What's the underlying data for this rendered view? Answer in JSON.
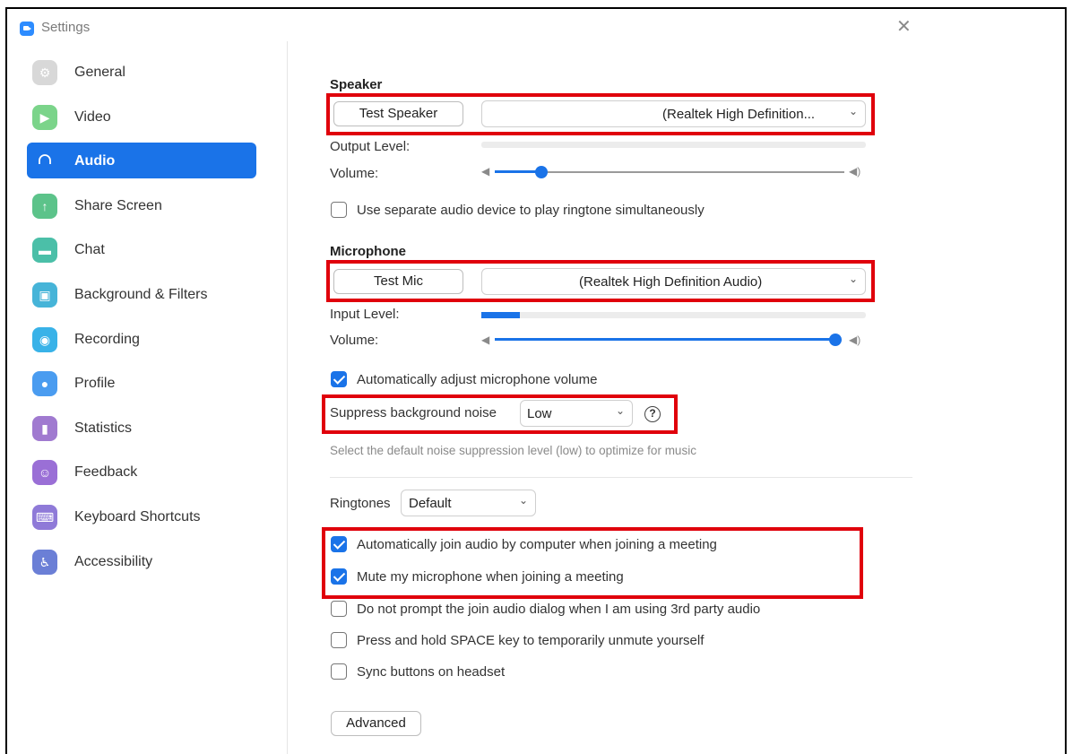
{
  "window": {
    "title": "Settings",
    "close_glyph": "✕"
  },
  "sidebar": {
    "items": [
      {
        "label": "General",
        "icon": "gear-icon"
      },
      {
        "label": "Video",
        "icon": "video-camera-icon"
      },
      {
        "label": "Audio",
        "icon": "headphones-icon",
        "active": true
      },
      {
        "label": "Share Screen",
        "icon": "share-screen-icon"
      },
      {
        "label": "Chat",
        "icon": "chat-bubble-icon"
      },
      {
        "label": "Background & Filters",
        "icon": "background-icon"
      },
      {
        "label": "Recording",
        "icon": "record-icon"
      },
      {
        "label": "Profile",
        "icon": "profile-icon"
      },
      {
        "label": "Statistics",
        "icon": "bar-chart-icon"
      },
      {
        "label": "Feedback",
        "icon": "smiley-icon"
      },
      {
        "label": "Keyboard Shortcuts",
        "icon": "keyboard-icon"
      },
      {
        "label": "Accessibility",
        "icon": "accessibility-icon"
      }
    ]
  },
  "speaker": {
    "title": "Speaker",
    "test_button": "Test Speaker",
    "device": "(Realtek High Definition...",
    "output_level_label": "Output Level:",
    "output_level": 0.0,
    "volume_label": "Volume:",
    "volume": 0.12
  },
  "ringtone_separate": {
    "label": "Use separate audio device to play ringtone simultaneously",
    "checked": false
  },
  "microphone": {
    "title": "Microphone",
    "test_button": "Test Mic",
    "device": "(Realtek High Definition Audio)",
    "input_level_label": "Input Level:",
    "input_level": 0.1,
    "volume_label": "Volume:",
    "volume": 1.0
  },
  "auto_adjust_mic": {
    "label": "Automatically adjust microphone volume",
    "checked": true
  },
  "suppress_noise": {
    "label": "Suppress background noise",
    "value": "Low",
    "help_glyph": "?",
    "hint": "Select the default noise suppression level (low) to optimize for music"
  },
  "ringtones": {
    "label": "Ringtones",
    "value": "Default"
  },
  "options": [
    {
      "label": "Automatically join audio by computer when joining a meeting",
      "checked": true
    },
    {
      "label": "Mute my microphone when joining a meeting",
      "checked": true
    },
    {
      "label": "Do not prompt the join audio dialog when I am using 3rd party audio",
      "checked": false
    },
    {
      "label": "Press and hold SPACE key to temporarily unmute yourself",
      "checked": false
    },
    {
      "label": "Sync buttons on headset",
      "checked": false
    }
  ],
  "advanced_button": "Advanced",
  "colors": {
    "accent": "#1a73e8",
    "highlight": "#e0000b"
  }
}
